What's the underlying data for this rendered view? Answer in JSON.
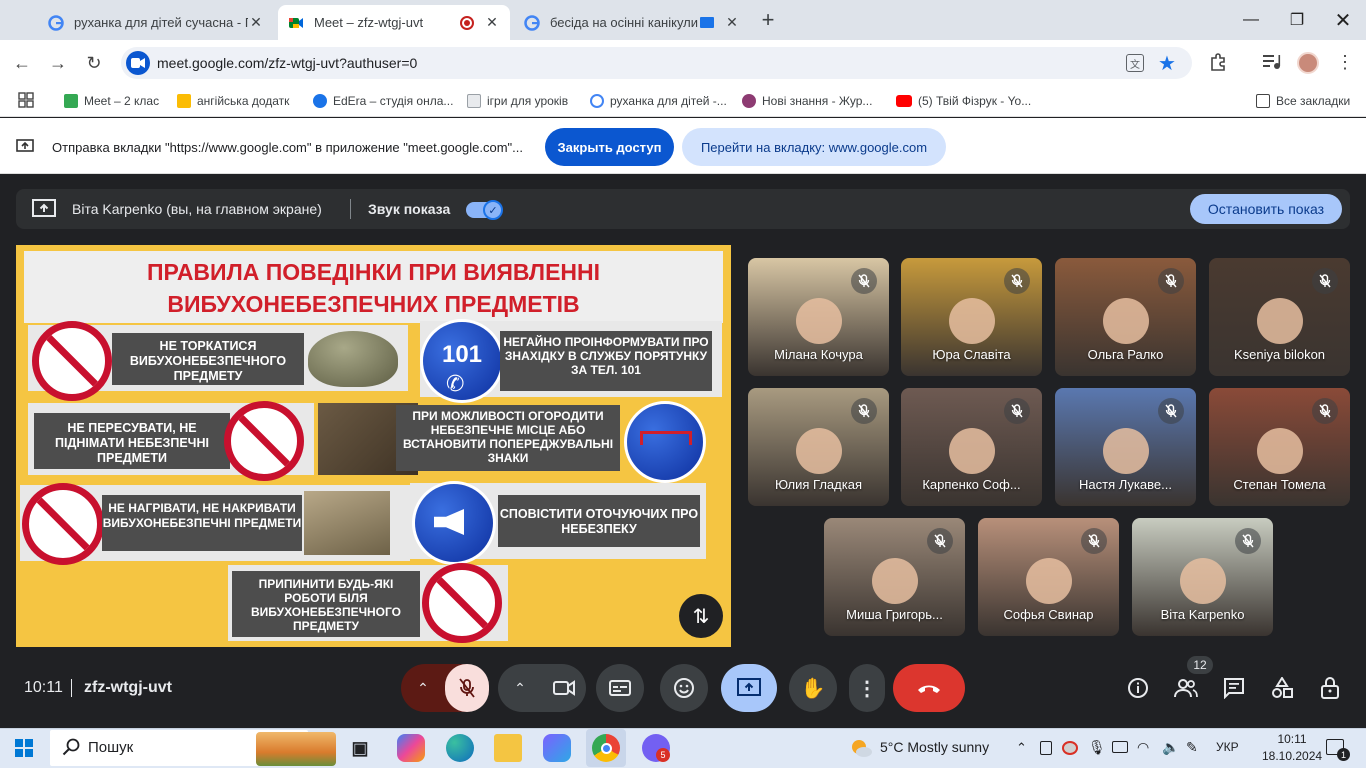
{
  "browser": {
    "tabs": [
      {
        "title": "руханка для дітей сучасна - По",
        "icon": "google-g-icon"
      },
      {
        "title": "Meet – zfz-wtgj-uvt",
        "icon": "meet-icon",
        "active": true
      },
      {
        "title": "бесіда на осінні канікули -",
        "icon": "google-g-icon"
      }
    ],
    "url": "meet.google.com/zfz-wtgj-uvt?authuser=0",
    "bookmarks": [
      {
        "label": "Meet – 2 клас",
        "color": "#34a853"
      },
      {
        "label": "ангійська додатк",
        "color": "#fbbc04"
      },
      {
        "label": "EdEra – студія онла...",
        "color": "#1a73e8"
      },
      {
        "label": "ігри для уроків",
        "color": "#9aa0a6"
      },
      {
        "label": "руханка для дітей -...",
        "color": "#4285f4"
      },
      {
        "label": "Нові знання - Жур...",
        "color": "#8d3b72"
      },
      {
        "label": "(5) Твій Фізрук - Yo...",
        "color": "#ff0000"
      }
    ],
    "all_bookmarks": "Все закладки"
  },
  "infobar": {
    "text": "Отправка вкладки \"https://www.google.com\" в приложение \"meet.google.com\"...",
    "stop_button": "Закрыть доступ",
    "goto_button": "Перейти на вкладку: www.google.com"
  },
  "presentation": {
    "presenter": "Віта Karpenko (вы, на главном экране)",
    "sound_label": "Звук показа",
    "sound_on": true,
    "stop_button": "Остановить показ"
  },
  "poster": {
    "title_line1": "ПРАВИЛА ПОВЕДІНКИ ПРИ ВИЯВЛЕННІ",
    "title_line2": "ВИБУХОНЕБЕЗПЕЧНИХ ПРЕДМЕТІВ",
    "rule1": "НЕ ТОРКАТИСЯ ВИБУХОНЕБЕЗПЕЧНОГО ПРЕДМЕТУ",
    "rule2": "НЕГАЙНО ПРОІНФОРМУВАТИ ПРО ЗНАХІДКУ В СЛУЖБУ ПОРЯТУНКУ ЗА ТЕЛ. 101",
    "rule2_number": "101",
    "rule3": "НЕ ПЕРЕСУВАТИ, НЕ ПІДНІМАТИ НЕБЕЗПЕЧНІ ПРЕДМЕТИ",
    "rule4": "ПРИ МОЖЛИВОСТІ ОГОРОДИТИ НЕБЕЗПЕЧНЕ МІСЦЕ АБО ВСТАНОВИТИ ПОПЕРЕДЖУВАЛЬНІ ЗНАКИ",
    "rule5": "НЕ НАГРІВАТИ, НЕ НАКРИВАТИ ВИБУХОНЕБЕЗПЕЧНІ ПРЕДМЕТИ",
    "rule6": "СПОВІСТИТИ ОТОЧУЮЧИХ ПРО НЕБЕЗПЕКУ",
    "rule7": "ПРИПИНИТИ БУДЬ-ЯКІ РОБОТИ БІЛЯ ВИБУХОНЕБЕЗПЕЧНОГО ПРЕДМЕТУ"
  },
  "participants": [
    {
      "name": "Мілана Кочура",
      "bg": "#d8c6a4"
    },
    {
      "name": "Юра Славіта",
      "bg": "#c79a3c"
    },
    {
      "name": "Ольга Ралко",
      "bg": "#8a5a3c"
    },
    {
      "name": "Kseniya bilokon",
      "bg": "#4a3a30"
    },
    {
      "name": "Юлия Гладкая",
      "bg": "#a89a80"
    },
    {
      "name": "Карпенко Соф...",
      "bg": "#6e5a52"
    },
    {
      "name": "Настя Лукаве...",
      "bg": "#5a78b0"
    },
    {
      "name": "Степан Томела",
      "bg": "#8a4a38"
    },
    {
      "name": "Миша Григорь...",
      "bg": "#9a8878"
    },
    {
      "name": "Софья Свинар",
      "bg": "#b8907a"
    },
    {
      "name": "Віта Karpenko",
      "bg": "#c8ccc0"
    }
  ],
  "callbar": {
    "time": "10:11",
    "meeting_code": "zfz-wtgj-uvt",
    "participant_count": "12"
  },
  "taskbar": {
    "search_placeholder": "Пошук",
    "weather": "5°C  Mostly sunny",
    "language": "УКР",
    "time": "10:11",
    "date": "18.10.2024",
    "viber_badge": "5",
    "notif_badge": "1"
  }
}
